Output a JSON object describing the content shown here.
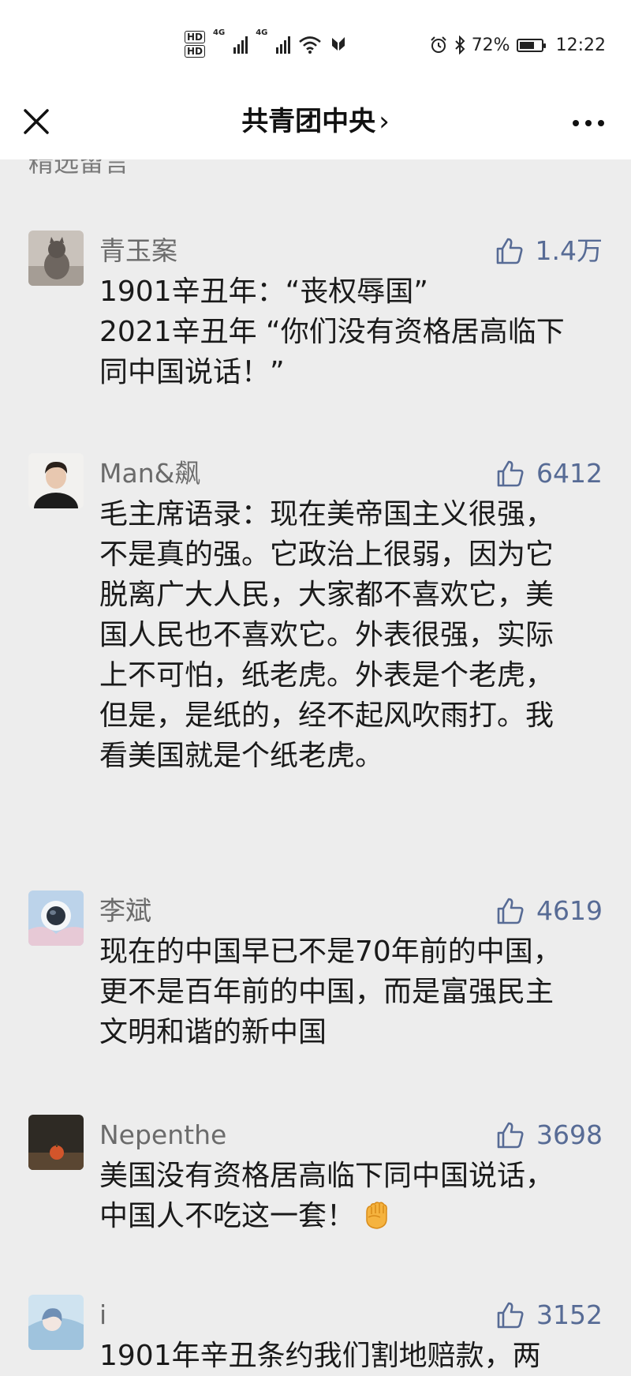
{
  "status": {
    "hd1": "HD",
    "hd2": "HD",
    "net1": "4G",
    "net2": "4G",
    "battery_percent": 72,
    "battery_text": "72%",
    "time": "12:22"
  },
  "navbar": {
    "title": "共青团中央",
    "chevron": "›"
  },
  "section": {
    "header": "精选留言"
  },
  "comments": [
    {
      "name": "青玉案",
      "likes": "1.4万",
      "text": "1901辛丑年：“丧权辱国”\n2021辛丑年 “你们没有资格居高临下同中国说话！”"
    },
    {
      "name": "Man&飙",
      "likes": "6412",
      "text": "毛主席语录：现在美帝国主义很强，不是真的强。它政治上很弱，因为它脱离广大人民，大家都不喜欢它，美国人民也不喜欢它。外表很强，实际上不可怕，纸老虎。外表是个老虎，但是，是纸的，经不起风吹雨打。我看美国就是个纸老虎。"
    },
    {
      "name": "李斌",
      "likes": "4619",
      "text": "现在的中国早已不是70年前的中国，更不是百年前的中国，而是富强民主文明和谐的新中国"
    },
    {
      "name": "Nepenthe",
      "likes": "3698",
      "text": "美国没有资格居高临下同中国说话，中国人不吃这一套！"
    },
    {
      "name": "i",
      "likes": "3152",
      "text": "1901年辛丑条约我们割地赔款，两"
    }
  ],
  "icons": {
    "close": "close-icon",
    "more": "more-dots-icon",
    "like": "thumbs-up-icon",
    "fist": "raised-fist-emoji"
  },
  "colors": {
    "like_blue": "#576b95",
    "name_gray": "#6b6b6b",
    "page_bg": "#ededed"
  }
}
